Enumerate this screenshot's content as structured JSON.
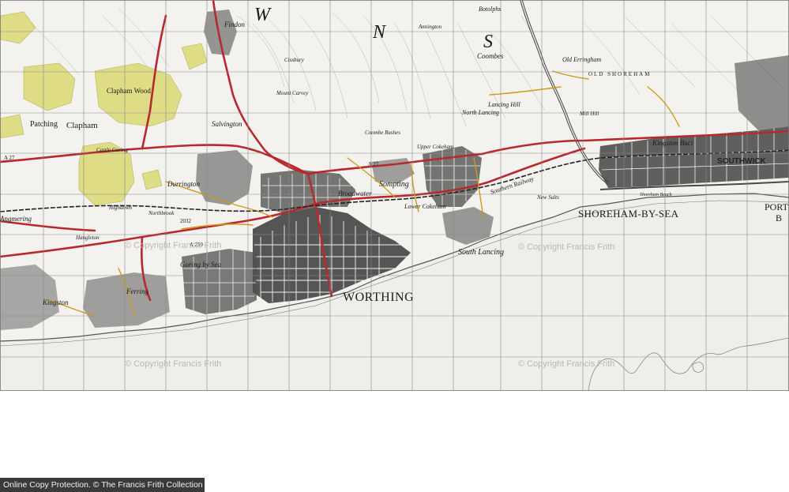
{
  "map": {
    "areas": {
      "worthing": "WORTHING",
      "shoreham": "SHOREHAM-BY-SEA",
      "southwick": "SOUTHWICK",
      "port": "PORT",
      "port2": "B"
    },
    "compass": [
      "W",
      "N",
      "S"
    ],
    "places": {
      "findon": "Findon",
      "clapham": "Clapham",
      "clapham_wood": "Clapham Wood",
      "patching": "Patching",
      "durrington": "Durrington",
      "salvington": "Salvington",
      "broadwater": "Broadwater",
      "sompting": "Sompting",
      "lower_cokeham": "Lower Cokeham",
      "south_lancing": "South Lancing",
      "north_lancing": "North Lancing",
      "lancing_hill": "Lancing Hill",
      "coombes": "Coombes",
      "old_erringham": "Old Erringham",
      "old_shoreham": "OLD SHOREHAM",
      "kingston_buci": "Kingston Buci",
      "kingston": "Kingston",
      "goring": "Goring by Sea",
      "ferring": "Ferring",
      "angmering": "Angmering",
      "mount_carvey": "Mount Carvey",
      "cissbury": "Cissbury",
      "coombe_bushes": "Coombe Bushes",
      "upper_cokeham": "Upper Cokeham",
      "mill_hill": "Mill Hill",
      "shoreham_beach": "Shoreham Beach",
      "southern_railway": "Southern Railway",
      "new_salts": "New Salts",
      "hangleton": "Hangleton",
      "northbrook": "Northbrook",
      "highdown": "Highdown",
      "castle_goring": "Castle Goring",
      "botolphs": "Botolphs",
      "annington": "Annington"
    },
    "roads": {
      "a27": "A 27",
      "a259": "A 259",
      "a2032": "2032"
    },
    "watermarks": [
      "© Copyright Francis Frith",
      "© Copyright Francis Frith",
      "© Copyright Francis Frith",
      "© Copyright Francis Frith"
    ]
  },
  "footer": {
    "text": "Online Copy Protection. © The Francis Frith Collection"
  },
  "colors": {
    "paper": "#f1f1ee",
    "sea": "#ececea",
    "grid": "#8a8a8a",
    "road_major": "#b8282c",
    "road_minor": "#d8a020",
    "woodland": "#dfe08a",
    "built_up": "#3c3c3c",
    "text": "#1a1a1a",
    "footer_bg": "#3a3a3a"
  }
}
